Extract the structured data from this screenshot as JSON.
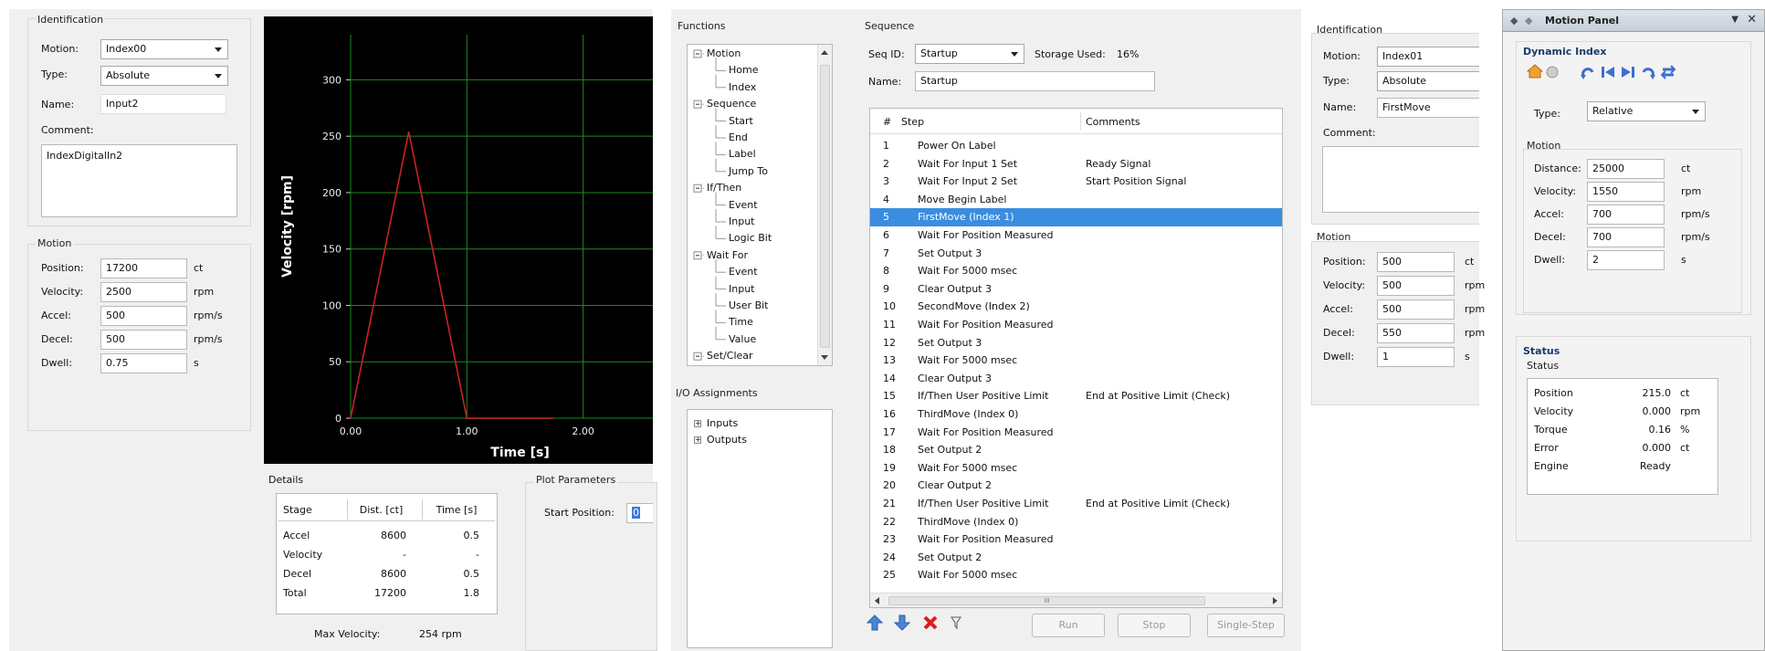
{
  "panel1": {
    "ident": {
      "title": "Identification",
      "motion_label": "Motion:",
      "motion_value": "Index00",
      "type_label": "Type:",
      "type_value": "Absolute",
      "name_label": "Name:",
      "name_value": "Input2",
      "comment_label": "Comment:",
      "comment_value": "IndexDigitalIn2"
    },
    "motion": {
      "title": "Motion",
      "rows": [
        {
          "label": "Position:",
          "value": "17200",
          "unit": "ct"
        },
        {
          "label": "Velocity:",
          "value": "2500",
          "unit": "rpm"
        },
        {
          "label": "Accel:",
          "value": "500",
          "unit": "rpm/s"
        },
        {
          "label": "Decel:",
          "value": "500",
          "unit": "rpm/s"
        },
        {
          "label": "Dwell:",
          "value": "0.75",
          "unit": "s"
        }
      ]
    }
  },
  "chart_data": {
    "type": "line",
    "xlabel": "Time [s]",
    "ylabel": "Velocity [rpm]",
    "xlim": [
      0,
      2.6
    ],
    "ylim": [
      0,
      340
    ],
    "x_ticks": [
      "0.00",
      "1.00",
      "2.00"
    ],
    "y_ticks": [
      "0",
      "50",
      "100",
      "150",
      "200",
      "250",
      "300"
    ],
    "grid": true,
    "background": "#000000",
    "grid_color": "#1d8a1d",
    "series": [
      {
        "color": "#cc2222",
        "x": [
          0,
          0.5,
          1.0,
          1.75
        ],
        "y": [
          0,
          254,
          0,
          0
        ]
      }
    ]
  },
  "details": {
    "title": "Details",
    "headers": [
      "Stage",
      "Dist. [ct]",
      "Time [s]"
    ],
    "rows": [
      [
        "Accel",
        "8600",
        "0.5"
      ],
      [
        "Velocity",
        "-",
        "-"
      ],
      [
        "Decel",
        "8600",
        "0.5"
      ],
      [
        "Total",
        "17200",
        "1.8"
      ]
    ],
    "max_velocity_label": "Max Velocity:",
    "max_velocity_value": "254 rpm"
  },
  "plot_params": {
    "title": "Plot Parameters",
    "start_label": "Start Position:",
    "start_value": "0"
  },
  "functions": {
    "title": "Functions",
    "tree": [
      {
        "label": "Motion",
        "level": 0,
        "sign": "−"
      },
      {
        "label": "Home",
        "level": 1
      },
      {
        "label": "Index",
        "level": 1
      },
      {
        "label": "Sequence",
        "level": 0,
        "sign": "−"
      },
      {
        "label": "Start",
        "level": 1
      },
      {
        "label": "End",
        "level": 1
      },
      {
        "label": "Label",
        "level": 1
      },
      {
        "label": "Jump To",
        "level": 1
      },
      {
        "label": "If/Then",
        "level": 0,
        "sign": "−"
      },
      {
        "label": "Event",
        "level": 1
      },
      {
        "label": "Input",
        "level": 1
      },
      {
        "label": "Logic Bit",
        "level": 1
      },
      {
        "label": "Wait For",
        "level": 0,
        "sign": "−"
      },
      {
        "label": "Event",
        "level": 1
      },
      {
        "label": "Input",
        "level": 1
      },
      {
        "label": "User Bit",
        "level": 1
      },
      {
        "label": "Time",
        "level": 1
      },
      {
        "label": "Value",
        "level": 1
      },
      {
        "label": "Set/Clear",
        "level": 0,
        "sign": "−"
      }
    ]
  },
  "io": {
    "title": "I/O Assignments",
    "items": [
      "Inputs",
      "Outputs"
    ]
  },
  "sequence": {
    "title": "Sequence",
    "seq_id_label": "Seq ID:",
    "seq_id_value": "Startup",
    "storage_label": "Storage Used:",
    "storage_value": "16%",
    "name_label": "Name:",
    "name_value": "Startup",
    "headers": [
      "#",
      "Step",
      "Comments"
    ],
    "rows": [
      [
        "1",
        "Power On Label",
        ""
      ],
      [
        "2",
        "Wait For Input 1 Set",
        "Ready Signal"
      ],
      [
        "3",
        "Wait For Input 2 Set",
        "Start Position Signal"
      ],
      [
        "4",
        "Move Begin Label",
        ""
      ],
      [
        "5",
        "FirstMove (Index 1)",
        ""
      ],
      [
        "6",
        "Wait For Position Measured",
        ""
      ],
      [
        "7",
        "Set Output 3",
        ""
      ],
      [
        "8",
        "Wait For 5000 msec",
        ""
      ],
      [
        "9",
        "Clear Output 3",
        ""
      ],
      [
        "10",
        "SecondMove (Index 2)",
        ""
      ],
      [
        "11",
        "Wait For Position Measured",
        ""
      ],
      [
        "12",
        "Set Output 3",
        ""
      ],
      [
        "13",
        "Wait For 5000 msec",
        ""
      ],
      [
        "14",
        "Clear Output 3",
        ""
      ],
      [
        "15",
        "If/Then User Positive Limit",
        "End at Positive Limit (Check)"
      ],
      [
        "16",
        "ThirdMove (Index 0)",
        ""
      ],
      [
        "17",
        "Wait For Position Measured",
        ""
      ],
      [
        "18",
        "Set Output 2",
        ""
      ],
      [
        "19",
        "Wait For 5000 msec",
        ""
      ],
      [
        "20",
        "Clear Output 2",
        ""
      ],
      [
        "21",
        "If/Then User Positive Limit",
        "End at Positive Limit (Check)"
      ],
      [
        "22",
        "ThirdMove (Index 0)",
        ""
      ],
      [
        "23",
        "Wait For Position Measured",
        ""
      ],
      [
        "24",
        "Set Output 2",
        ""
      ],
      [
        "25",
        "Wait For 5000 msec",
        ""
      ]
    ],
    "selected_index": 4,
    "buttons": {
      "run": "Run",
      "stop": "Stop",
      "single": "Single-Step"
    },
    "scroll_grip": "III"
  },
  "panel3": {
    "ident": {
      "title": "Identification",
      "motion_label": "Motion:",
      "motion_value": "Index01",
      "type_label": "Type:",
      "type_value": "Absolute",
      "name_label": "Name:",
      "name_value": "FirstMove",
      "comment_label": "Comment:"
    },
    "motion": {
      "title": "Motion",
      "rows": [
        {
          "label": "Position:",
          "value": "500",
          "unit": "ct"
        },
        {
          "label": "Velocity:",
          "value": "500",
          "unit": "rpm"
        },
        {
          "label": "Accel:",
          "value": "500",
          "unit": "rpm"
        },
        {
          "label": "Decel:",
          "value": "550",
          "unit": "rpm"
        },
        {
          "label": "Dwell:",
          "value": "1",
          "unit": "s"
        }
      ]
    }
  },
  "motion_panel": {
    "title": "Motion Panel",
    "dyn_title": "Dynamic Index",
    "type_label": "Type:",
    "type_value": "Relative",
    "motion_title": "Motion",
    "rows": [
      {
        "label": "Distance:",
        "value": "25000",
        "unit": "ct"
      },
      {
        "label": "Velocity:",
        "value": "1550",
        "unit": "rpm"
      },
      {
        "label": "Accel:",
        "value": "700",
        "unit": "rpm/s"
      },
      {
        "label": "Decel:",
        "value": "700",
        "unit": "rpm/s"
      },
      {
        "label": "Dwell:",
        "value": "2",
        "unit": "s"
      }
    ],
    "status_title": "Status",
    "status_sub": "Status",
    "status_rows": [
      {
        "label": "Position",
        "value": "215.0",
        "unit": "ct"
      },
      {
        "label": "Velocity",
        "value": "0.000",
        "unit": "rpm"
      },
      {
        "label": "Torque",
        "value": "0.16",
        "unit": "%"
      },
      {
        "label": "Error",
        "value": "0.000",
        "unit": "ct"
      },
      {
        "label": "Engine",
        "value": "Ready",
        "unit": ""
      }
    ]
  }
}
